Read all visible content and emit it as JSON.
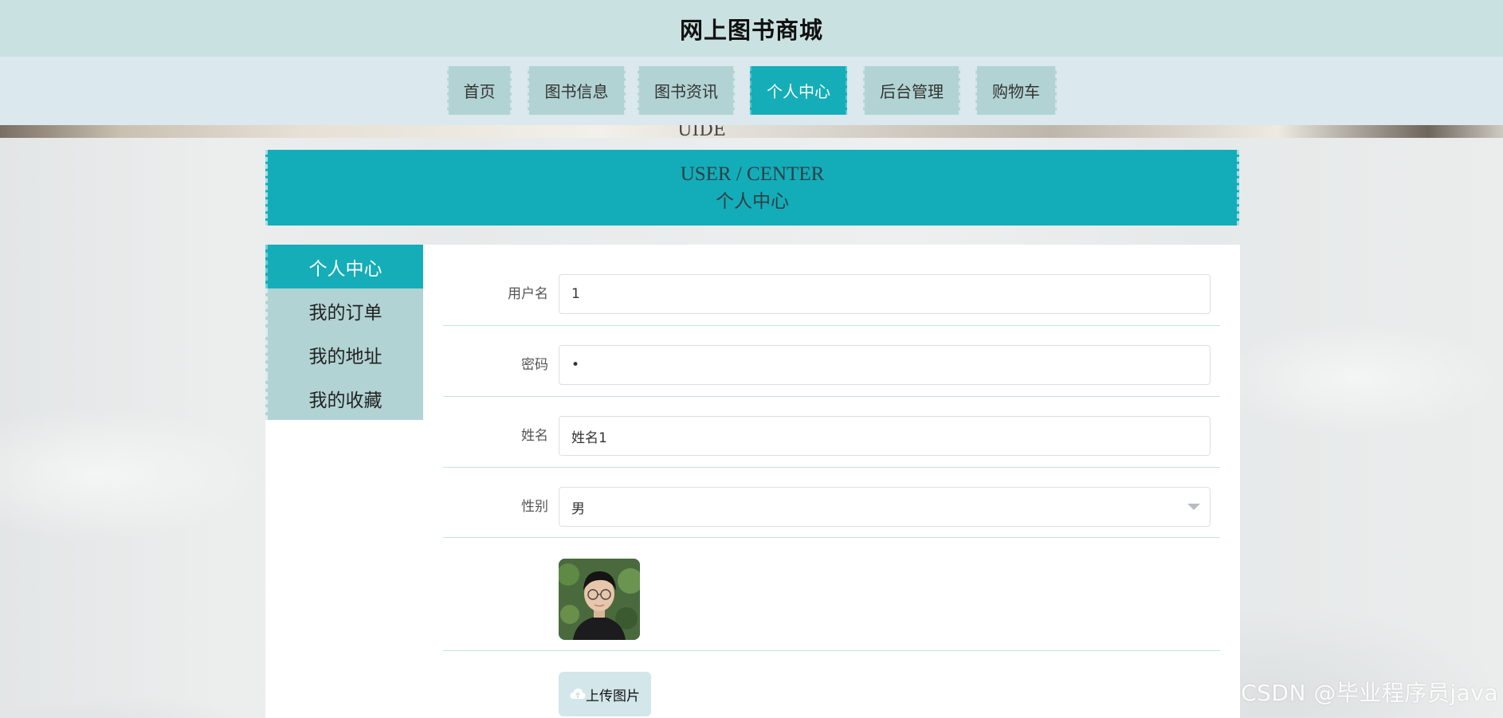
{
  "site": {
    "title": "网上图书商城"
  },
  "nav": {
    "items": [
      {
        "label": "首页"
      },
      {
        "label": "图书信息"
      },
      {
        "label": "图书资讯"
      },
      {
        "label": "个人中心",
        "active": true
      },
      {
        "label": "后台管理"
      },
      {
        "label": "购物车"
      }
    ]
  },
  "banner": {
    "en": "USER / CENTER",
    "cn": "个人中心"
  },
  "sidebar": {
    "items": [
      {
        "label": "个人中心",
        "active": true
      },
      {
        "label": "我的订单"
      },
      {
        "label": "我的地址"
      },
      {
        "label": "我的收藏"
      }
    ]
  },
  "form": {
    "username": {
      "label": "用户名",
      "value": "1"
    },
    "password": {
      "label": "密码",
      "value": "•"
    },
    "name": {
      "label": "姓名",
      "value": "姓名1"
    },
    "gender": {
      "label": "性别",
      "value": "男"
    },
    "upload_label": "上传图片"
  },
  "watermark": "CSDN @毕业程序员java",
  "colors": {
    "accent": "#15adb8",
    "nav_bg": "#b2d3d3",
    "topbar": "#c9e1e1"
  },
  "icons": {
    "upload": "cloud-upload-icon",
    "select": "chevron-down-icon"
  }
}
